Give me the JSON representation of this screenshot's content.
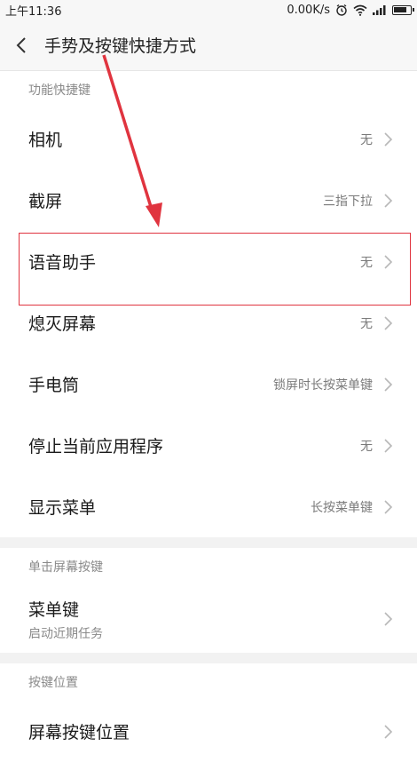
{
  "status_bar": {
    "time": "上午11:36",
    "network_speed": "0.00K/s"
  },
  "header": {
    "title": "手势及按键快捷方式"
  },
  "sections": {
    "function_shortcuts": {
      "header": "功能快捷键",
      "items": [
        {
          "label": "相机",
          "value": "无"
        },
        {
          "label": "截屏",
          "value": "三指下拉"
        },
        {
          "label": "语音助手",
          "value": "无"
        },
        {
          "label": "熄灭屏幕",
          "value": "无"
        },
        {
          "label": "手电筒",
          "value": "锁屏时长按菜单键"
        },
        {
          "label": "停止当前应用程序",
          "value": "无"
        },
        {
          "label": "显示菜单",
          "value": "长按菜单键"
        }
      ]
    },
    "tap_screen_button": {
      "header": "单击屏幕按键",
      "items": [
        {
          "label": "菜单键",
          "subtitle": "启动近期任务"
        }
      ]
    },
    "button_position": {
      "header": "按键位置",
      "items": [
        {
          "label": "屏幕按键位置"
        }
      ]
    }
  },
  "annotation": {
    "color": "#e0343f"
  }
}
